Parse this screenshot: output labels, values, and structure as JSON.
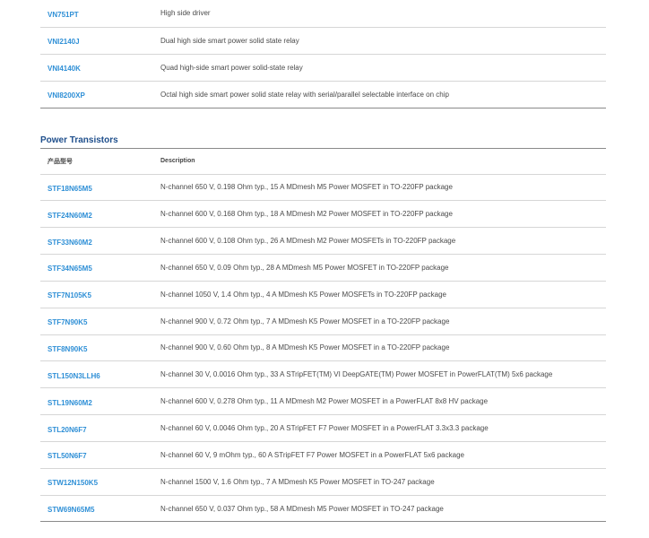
{
  "top_rows": [
    {
      "part": "VN751PT",
      "description": "High side driver"
    },
    {
      "part": "VNI2140J",
      "description": "Dual high side smart power solid state relay"
    },
    {
      "part": "VNI4140K",
      "description": "Quad high-side smart power solid-state relay"
    },
    {
      "part": "VNI8200XP",
      "description": "Octal high side smart power solid state relay with serial/parallel selectable interface on chip"
    }
  ],
  "power_transistors": {
    "title": "Power Transistors",
    "headers": {
      "part": "产品型号",
      "description": "Description"
    },
    "rows": [
      {
        "part": "STF18N65M5",
        "description": "N-channel 650 V, 0.198 Ohm typ., 15 A MDmesh M5 Power MOSFET in TO-220FP package"
      },
      {
        "part": "STF24N60M2",
        "description": "N-channel 600 V, 0.168 Ohm typ., 18 A MDmesh M2 Power MOSFET in TO-220FP package"
      },
      {
        "part": "STF33N60M2",
        "description": "N-channel 600 V, 0.108 Ohm typ., 26 A MDmesh M2 Power MOSFETs in TO-220FP package"
      },
      {
        "part": "STF34N65M5",
        "description": "N-channel 650 V, 0.09 Ohm typ., 28 A MDmesh M5 Power MOSFET in TO-220FP package"
      },
      {
        "part": "STF7N105K5",
        "description": "N-channel 1050 V, 1.4 Ohm typ., 4 A MDmesh K5 Power MOSFETs in TO-220FP package"
      },
      {
        "part": "STF7N90K5",
        "description": "N-channel 900 V, 0.72 Ohm typ., 7 A MDmesh K5 Power MOSFET in a TO-220FP package"
      },
      {
        "part": "STF8N90K5",
        "description": "N-channel 900 V, 0.60 Ohm typ., 8 A MDmesh K5 Power MOSFET in a TO-220FP package"
      },
      {
        "part": "STL150N3LLH6",
        "description": "N-channel 30 V, 0.0016 Ohm typ., 33 A STripFET(TM) VI DeepGATE(TM) Power MOSFET in PowerFLAT(TM) 5x6 package"
      },
      {
        "part": "STL19N60M2",
        "description": "N-channel 600 V, 0.278 Ohm typ., 11 A MDmesh M2 Power MOSFET in a PowerFLAT 8x8 HV package"
      },
      {
        "part": "STL20N6F7",
        "description": "N-channel 60 V, 0.0046 Ohm typ., 20 A STripFET F7 Power MOSFET in a PowerFLAT 3.3x3.3 package"
      },
      {
        "part": "STL50N6F7",
        "description": "N-channel 60 V, 9 mOhm typ., 60 A STripFET F7 Power MOSFET in a PowerFLAT 5x6 package"
      },
      {
        "part": "STW12N150K5",
        "description": "N-channel 1500 V, 1.6 Ohm typ., 7 A MDmesh K5 Power MOSFET in TO-247 package"
      },
      {
        "part": "STW69N65M5",
        "description": "N-channel 650 V, 0.037 Ohm typ., 58 A MDmesh M5 Power MOSFET in TO-247 package"
      }
    ]
  },
  "colors": {
    "link": "#2e8fd6",
    "section_title": "#1f4f8c",
    "divider": "#d6d6d6",
    "table_edge": "#8a8a8a"
  }
}
